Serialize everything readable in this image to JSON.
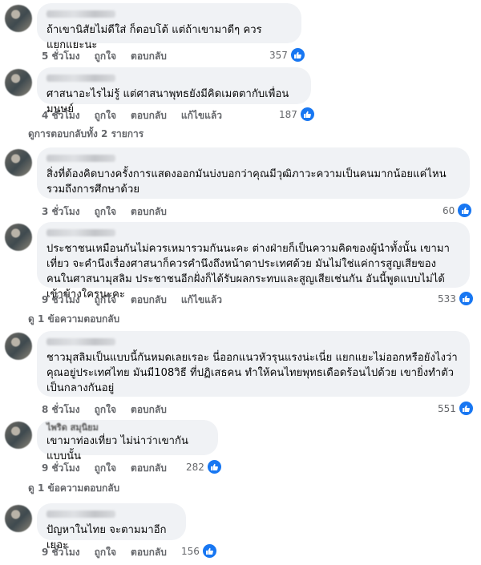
{
  "actions": {
    "like": "ถูกใจ",
    "reply": "ตอบกลับ",
    "edit": "แก้ไขแล้ว"
  },
  "comments": [
    {
      "text": "ถ้าเขานิสัยไม่ดีใส่ ก็ตอบโต้ แต่ถ้าเขามาดีๆ ควรแยกแยะนะ",
      "time": "5 ชั่วโมง",
      "likes": "357"
    },
    {
      "text": "ศาสนาอะไรไม่รู้ แต่ศาสนาพุทธยังมีคิดเมตตากับเพื่อนมนุษย์",
      "time": "4 ชั่วโมง",
      "likes": "187",
      "replies": "ดูการตอบกลับทั้ง 2 รายการ"
    },
    {
      "text": "สิ่งที่ต้องคิดบางครั้งการแสดงออกมันบ่งบอกว่าคุณมีวุฒิภาวะความเป็นคนมากน้อยแค่ไหนรวมถึงการศึกษาด้วย",
      "time": "3 ชั่วโมง",
      "likes": "60"
    },
    {
      "text": "ประชาชนเหมือนกันไม่ควรเหมารวมกันนะคะ ต่างฝ่ายก็เป็นความคิดของผู้นำทั้งนั้น เขามาเที่ยว จะคำนึงเรื่องศาสนาก็ควรคำนึงถึงหน้าตาประเทศด้วย มันไม่ใช่แค่การสูญเสียของคนในศาสนามุสลิม ประชาชนอีกฝั่งก็ได้รับผลกระทบและสูญเสียเช่นกัน อันนี้พูดแบบไม่ได้เข้าข้างใครนะคะ",
      "time": "9 ชั่วโมง",
      "likes": "533",
      "replies": "ดู 1 ข้อความตอบกลับ"
    },
    {
      "text": "ชาวมุสลิมเป็นแบบนี้กันหมดเลยเรอะ นี่ออกแนวหัวรุนแรงน่ะเนี่ย แยกแยะไม่ออกหรือยังไงว่าคุณอยู่ประเทศไทย มันมี108วิธี ที่ปฏิเสธคน ทำให้คนไทยพุทธเดือดร้อนไปด้วย เขายิ่งทำตัวเป็นกลางกันอยู่",
      "time": "8 ชั่วโมง",
      "likes": "551"
    },
    {
      "name": "ไพริด สมุนิยม",
      "text": "เขามาท่องเที่ยว ไม่น่าว่าเขากันแบบนั้น",
      "time": "9 ชั่วโมง",
      "likes": "282",
      "replies": "ดู 1 ข้อความตอบกลับ"
    },
    {
      "text": "ปัญหาในไทย จะตามมาอีกเยอะ",
      "time": "9 ชั่วโมง",
      "likes": "156"
    }
  ]
}
